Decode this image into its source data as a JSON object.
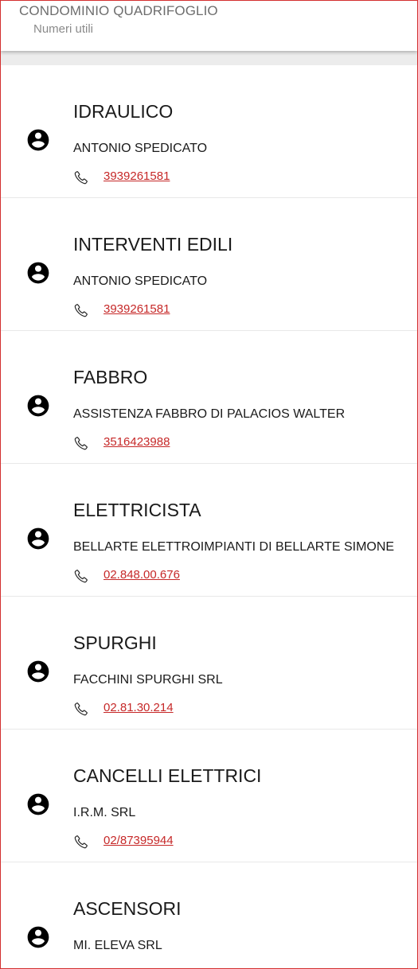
{
  "header": {
    "title": "CONDOMINIO QUADRIFOGLIO",
    "subtitle": "Numeri utili"
  },
  "contacts": [
    {
      "category": "IDRAULICO",
      "name": "ANTONIO SPEDICATO",
      "phone": "3939261581"
    },
    {
      "category": "INTERVENTI EDILI",
      "name": "ANTONIO SPEDICATO",
      "phone": "3939261581"
    },
    {
      "category": "FABBRO",
      "name": "ASSISTENZA FABBRO DI PALACIOS WALTER",
      "phone": "3516423988"
    },
    {
      "category": "ELETTRICISTA",
      "name": "BELLARTE ELETTROIMPIANTI DI BELLARTE SIMONE",
      "phone": "02.848.00.676"
    },
    {
      "category": "SPURGHI",
      "name": "FACCHINI SPURGHI SRL",
      "phone": "02.81.30.214"
    },
    {
      "category": "CANCELLI ELETTRICI",
      "name": "I.R.M. SRL",
      "phone": "02/87395944"
    },
    {
      "category": "ASCENSORI",
      "name": "MI. ELEVA SRL",
      "phone": ""
    }
  ],
  "icons": {
    "avatar": "account-circle-icon",
    "phone": "phone-icon"
  },
  "colors": {
    "link": "#c62828",
    "border": "#d32f2f"
  }
}
